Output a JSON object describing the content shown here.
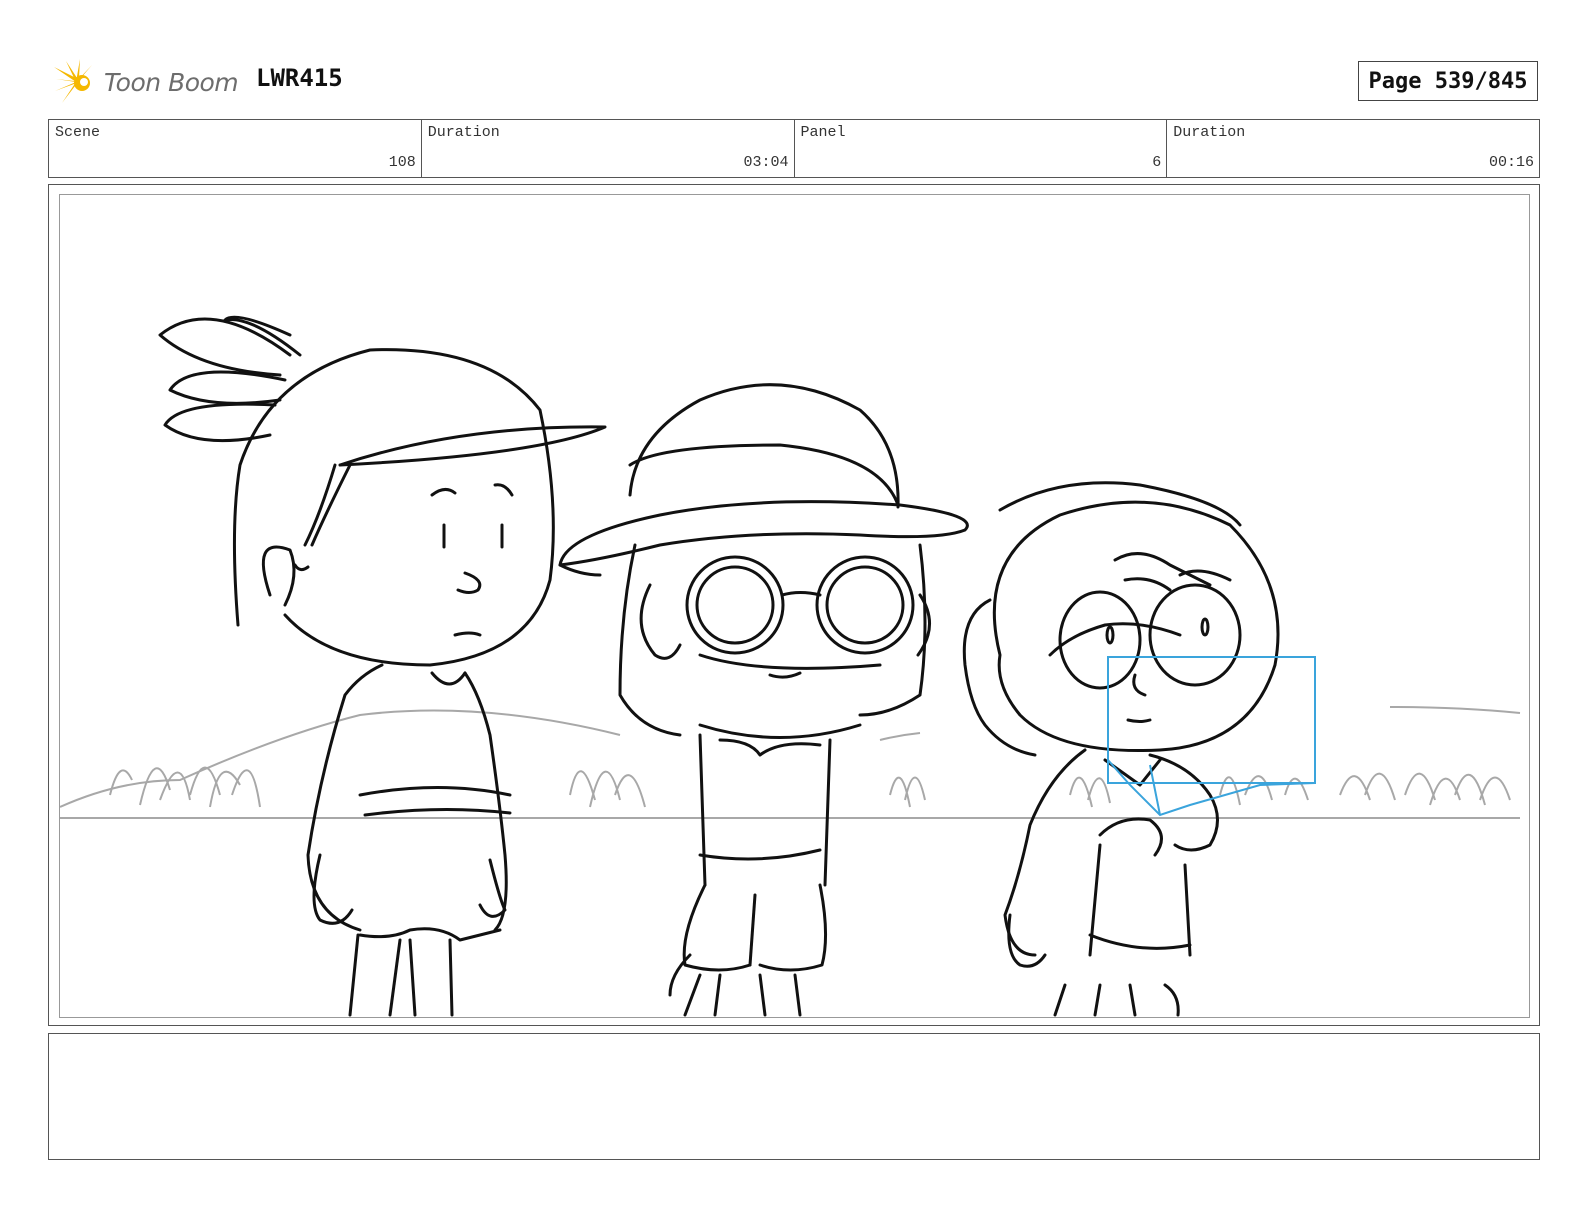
{
  "header": {
    "logo_text": "Toon Boom",
    "logo_icon": "starburst-logo-icon",
    "project_code": "LWR415",
    "page_label": "Page 539/845"
  },
  "info": [
    {
      "label": "Scene",
      "value": "108"
    },
    {
      "label": "Duration",
      "value": "03:04"
    },
    {
      "label": "Panel",
      "value": "6"
    },
    {
      "label": "Duration",
      "value": "00:16"
    }
  ],
  "colors": {
    "logo_yellow": "#f5b800",
    "sketch_ink": "#111111",
    "background_sketch": "#a8a8a8",
    "camera_guide": "#3aa4dc"
  },
  "notes": {
    "text": ""
  }
}
